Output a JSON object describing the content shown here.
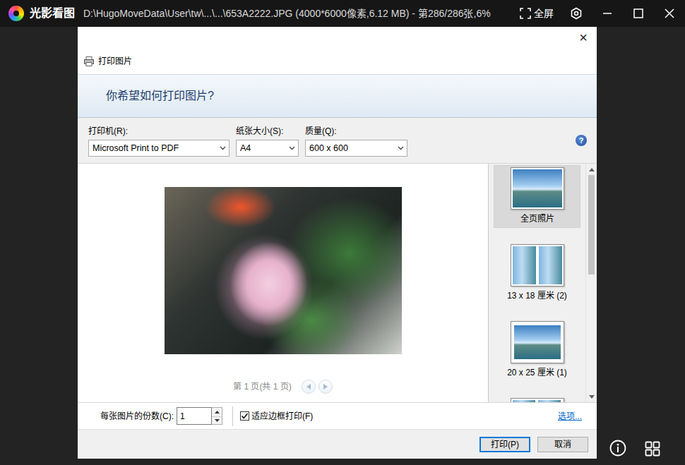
{
  "app": {
    "name": "光影看图",
    "title": "D:\\HugoMoveData\\User\\tw\\...\\...\\653A2222.JPG (4000*6000像素,6.12 MB) - 第286/286张,6%",
    "fullscreen": "全屏"
  },
  "dialog": {
    "close": "×",
    "header": "打印图片",
    "question": "你希望如何打印图片?",
    "help": "?",
    "fields": [
      {
        "label": "打印机(R):",
        "value": "Microsoft Print to PDF"
      },
      {
        "label": "纸张大小(S):",
        "value": "A4"
      },
      {
        "label": "质量(Q):",
        "value": "600 x 600"
      }
    ],
    "preview": {
      "page": "第 1 页(共 1 页)",
      "nav": [
        {
          "direction": "prev",
          "disabled": true
        },
        {
          "direction": "next",
          "disabled": true
        }
      ]
    },
    "layouts": [
      {
        "label": "全页照片",
        "selected": true,
        "kind": "full"
      },
      {
        "label": "13 x 18 厘米 (2)",
        "selected": false,
        "kind": "double"
      },
      {
        "label": "20 x 25 厘米 (1)",
        "selected": false,
        "kind": "single"
      },
      {
        "selected": false,
        "kind": "quad"
      }
    ],
    "layout_scroll": {
      "thumb_start": 0.0,
      "thumb_share": 0.46
    },
    "copies": {
      "label": "每张图片的份数(C):",
      "value": "1"
    },
    "fit": {
      "label": "适应边框打印(F)",
      "checked": true
    },
    "options": "选项...",
    "buttons": [
      {
        "label": "打印(P)",
        "default": true
      },
      {
        "label": "取消",
        "default": false
      }
    ]
  }
}
